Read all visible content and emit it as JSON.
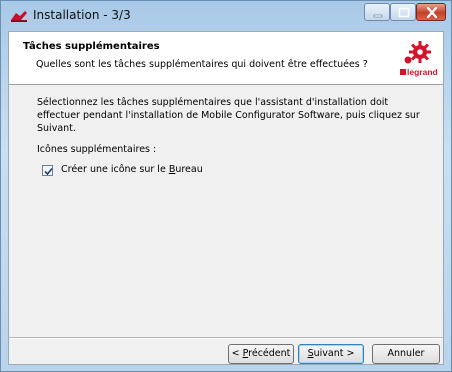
{
  "window": {
    "title": "Installation - 3/3"
  },
  "header": {
    "title": "Tâches supplémentaires",
    "subtitle": "Quelles sont les tâches supplémentaires qui doivent être effectuées ?",
    "logo_text": "legrand"
  },
  "main": {
    "description": "Sélectionnez les tâches supplémentaires que l'assistant d'installation doit effectuer pendant l'installation de Mobile Configurator Software, puis cliquez sur Suivant.",
    "extra_icons_label": "Icônes supplémentaires :",
    "checkbox": {
      "label_before": "Créer une icône sur le ",
      "label_mnemonic": "B",
      "label_after": "ureau",
      "checked": true
    }
  },
  "buttons": {
    "prev_before": "< ",
    "prev_mnemonic": "P",
    "prev_after": "récédent",
    "next_mnemonic": "S",
    "next_after": "uivant >",
    "cancel": "Annuler"
  },
  "colors": {
    "brand": "#d4142a",
    "title_bar": "#b9d3ec"
  }
}
